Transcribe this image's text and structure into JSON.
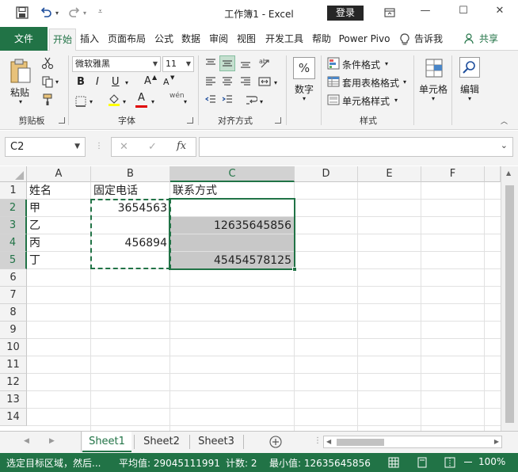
{
  "titlebar": {
    "title": "工作簿1  -  Excel",
    "login_label": "登录",
    "minimize": "—",
    "restore": "☐",
    "close": "✕"
  },
  "ribbon_tabs": {
    "file": "文件",
    "items": [
      "开始",
      "插入",
      "页面布局",
      "公式",
      "数据",
      "审阅",
      "视图",
      "开发工具",
      "帮助",
      "Power Pivo"
    ],
    "tellme": "告诉我",
    "share": "共享"
  },
  "ribbon": {
    "clipboard": {
      "paste": "粘贴",
      "label": "剪贴板"
    },
    "font": {
      "name": "微软雅黑",
      "size": "11",
      "bold": "B",
      "italic": "I",
      "underline": "U",
      "grow": "A",
      "shrink": "A",
      "font_color_letter": "A",
      "wen": "wén",
      "label": "字体"
    },
    "alignment": {
      "label": "对齐方式"
    },
    "number": {
      "button": "数字",
      "percent": "%"
    },
    "styles": {
      "conditional": "条件格式",
      "table": "套用表格格式",
      "cell": "单元格样式",
      "label": "样式"
    },
    "cells": {
      "button": "单元格"
    },
    "editing": {
      "button": "编辑"
    }
  },
  "formula_bar": {
    "name_box": "C2",
    "cancel": "✕",
    "enter": "✓",
    "fx": "fx",
    "formula": ""
  },
  "sheet": {
    "columns": [
      "A",
      "B",
      "C",
      "D",
      "E",
      "F"
    ],
    "rows": [
      "1",
      "2",
      "3",
      "4",
      "5",
      "6",
      "7",
      "8",
      "9",
      "10",
      "11",
      "12",
      "13",
      "14"
    ],
    "cells": {
      "A1": "姓名",
      "B1": "固定电话",
      "C1": "联系方式",
      "A2": "甲",
      "B2": "3654563",
      "C2": "",
      "A3": "乙",
      "B3": "",
      "C3": "12635645856",
      "A4": "丙",
      "B4": "456894",
      "C4": "",
      "A5": "丁",
      "B5": "",
      "C5": "45454578125"
    },
    "selected_cell": "C2",
    "fill_color": "#c8c8c8"
  },
  "sheet_tabs": [
    "Sheet1",
    "Sheet2",
    "Sheet3"
  ],
  "active_sheet": "Sheet1",
  "statusbar": {
    "message": "选定目标区域，然后...",
    "average": "平均值: 29045111991",
    "count": "计数: 2",
    "min": "最小值: 12635645856",
    "zoom": "100%"
  },
  "colors": {
    "excel_green": "#217346",
    "ribbon_bg": "#f3f3f3",
    "status_bar": "#217346"
  }
}
